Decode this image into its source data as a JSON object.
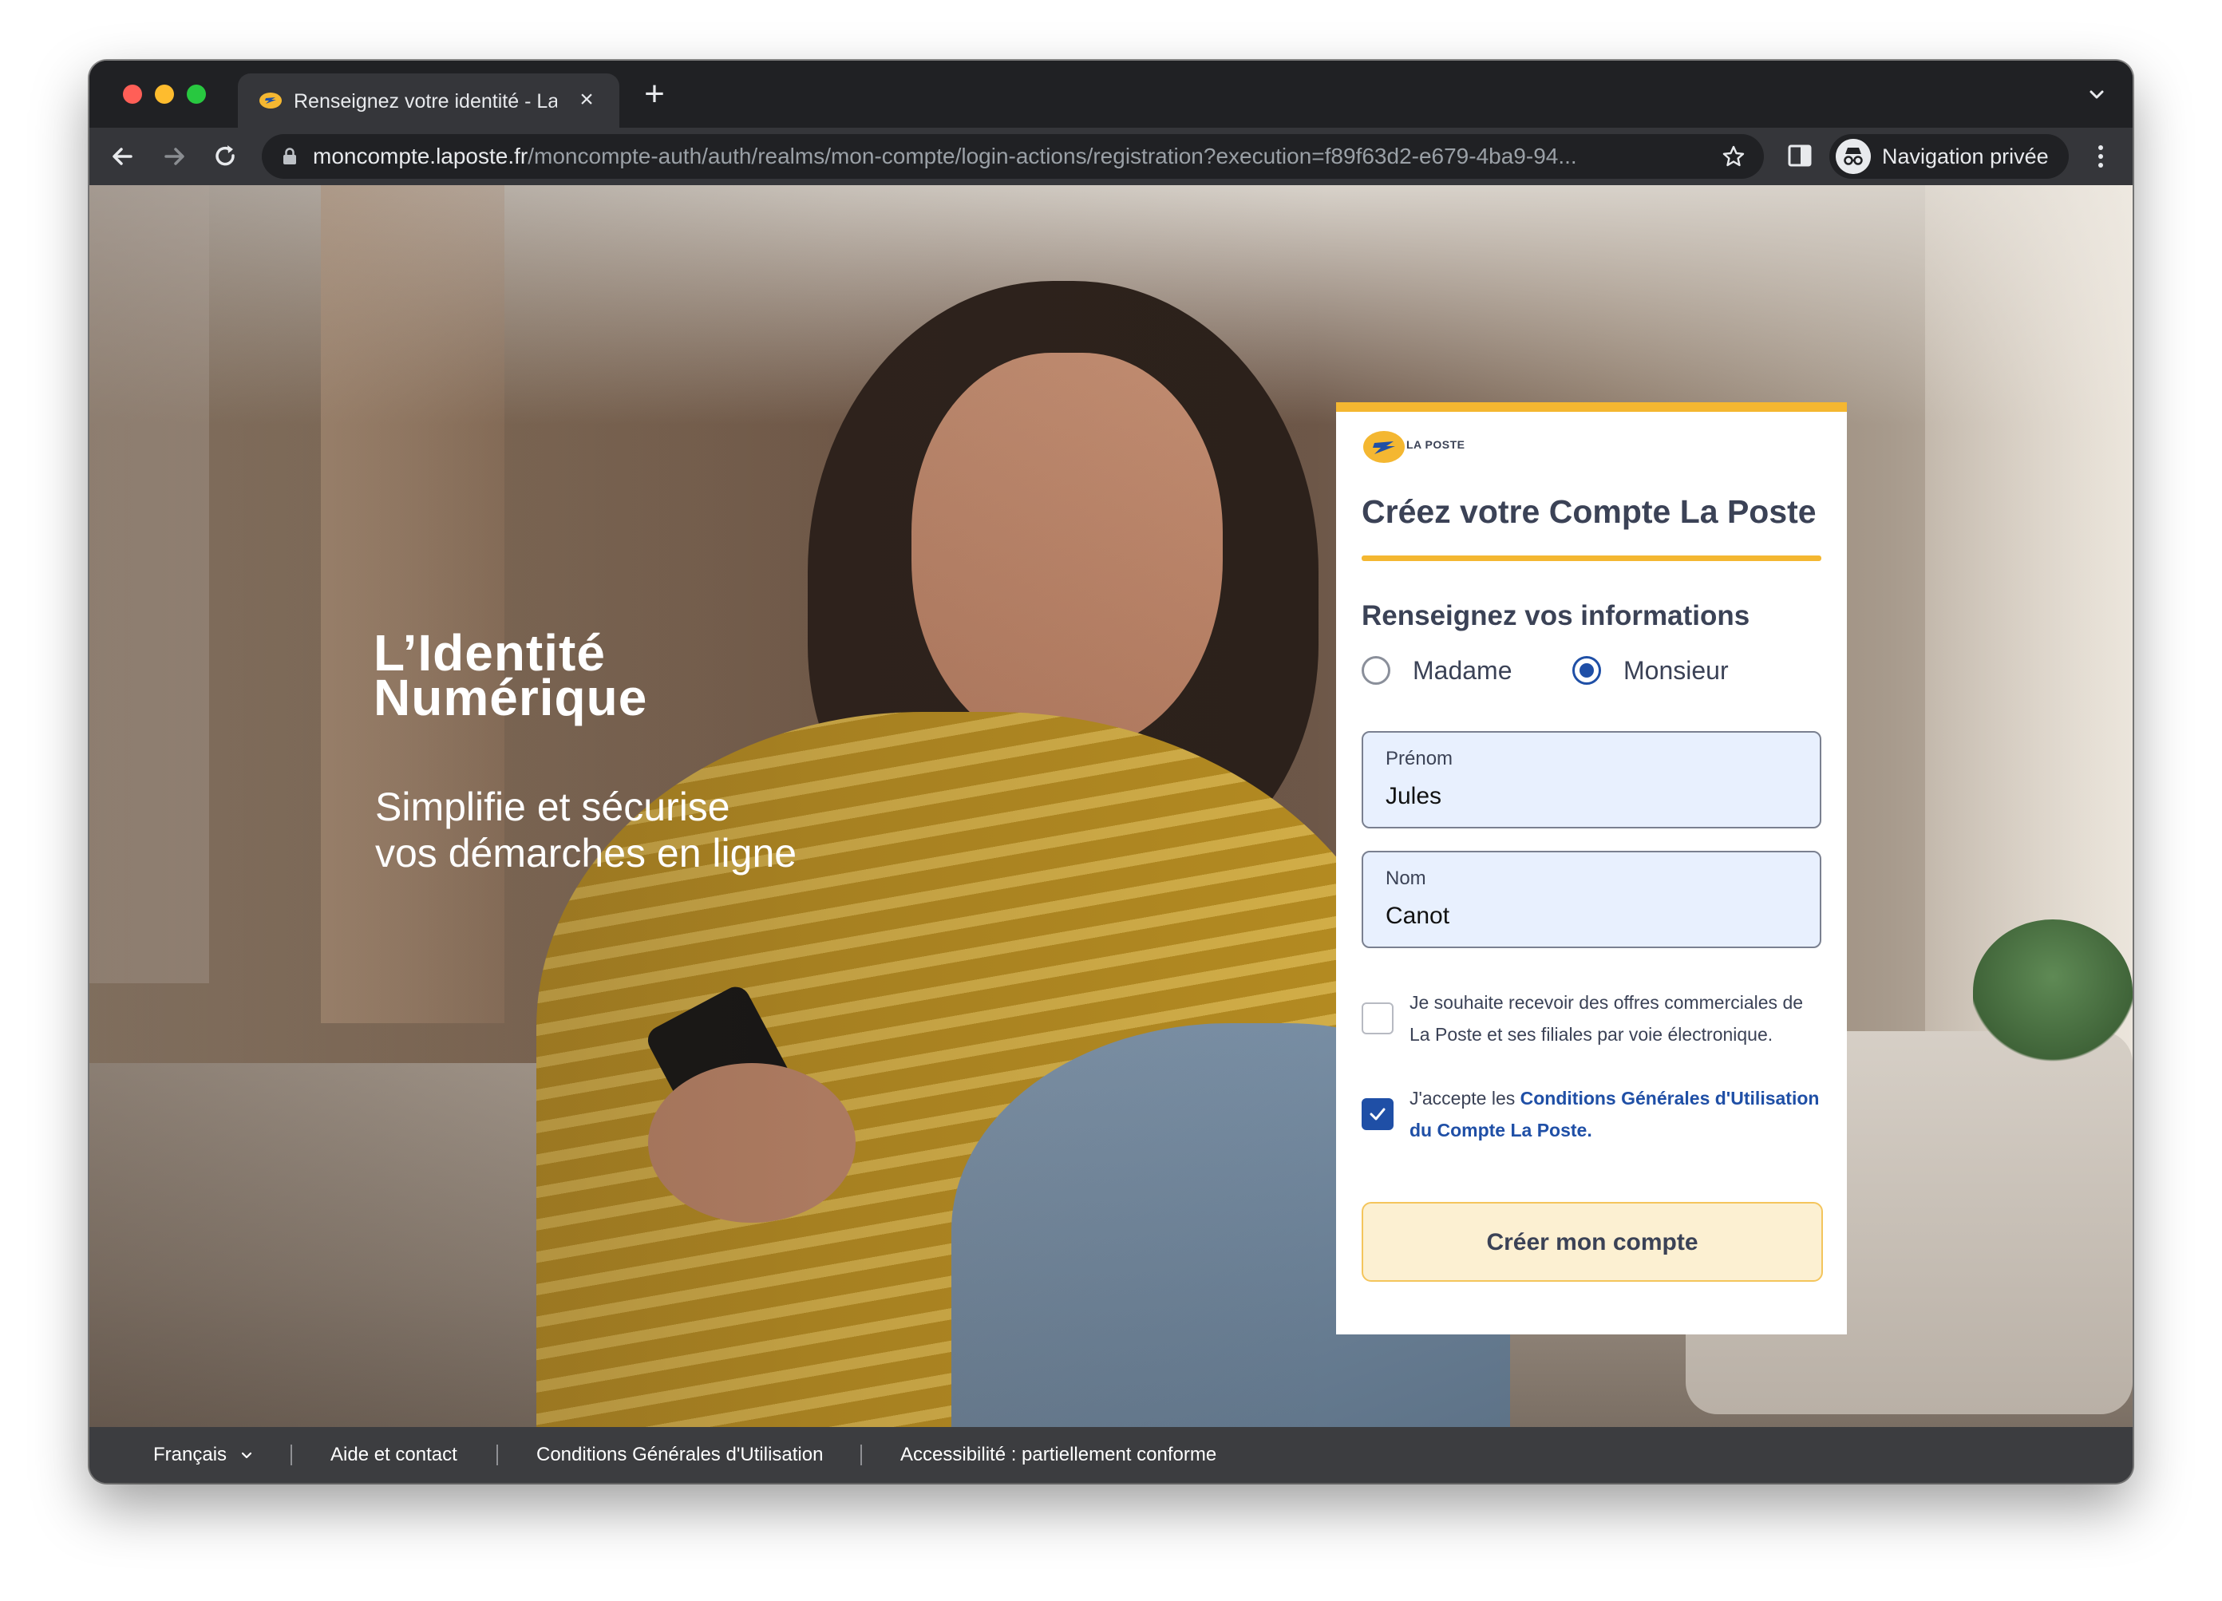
{
  "browser": {
    "tab_title": "Renseignez votre identité - La Poste",
    "url_host": "moncompte.laposte.fr",
    "url_path": "/moncompte-auth/auth/realms/mon-compte/login-actions/registration?execution=f89f63d2-e679-4ba9-94...",
    "profile_label": "Navigation privée"
  },
  "hero": {
    "title_line1": "L’Identité",
    "title_line2": "Numérique",
    "subtitle_line1": "Simplifie et sécurise",
    "subtitle_line2": "vos démarches en ligne"
  },
  "card": {
    "logo_text": "LA POSTE",
    "title": "Créez votre Compte La Poste",
    "section_title": "Renseignez vos informations",
    "civility": {
      "options": [
        "Madame",
        "Monsieur"
      ],
      "selected": "Monsieur"
    },
    "firstname": {
      "label": "Prénom",
      "value": "Jules"
    },
    "lastname": {
      "label": "Nom",
      "value": "Canot"
    },
    "offers_checkbox": {
      "text": "Je souhaite recevoir des offres commerciales de La Poste et ses filiales par voie électronique.",
      "checked": false
    },
    "cgu_checkbox": {
      "text_prefix": "J'accepte les ",
      "link_text": "Conditions Générales d'Utilisation du Compte La Poste.",
      "checked": true
    },
    "submit_label": "Créer mon compte"
  },
  "footer": {
    "language": "Français",
    "help": "Aide et contact",
    "cgu": "Conditions Générales d'Utilisation",
    "accessibility": "Accessibilité : partiellement conforme"
  },
  "colors": {
    "brand_yellow": "#f4b731",
    "brand_blue": "#1f4fa6",
    "text_dark": "#3b4256",
    "field_bg": "#e8f0fe"
  }
}
